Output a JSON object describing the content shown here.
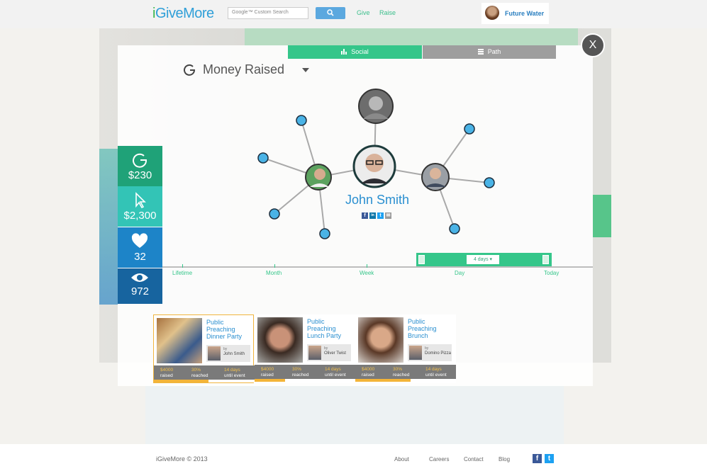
{
  "header": {
    "logo_prefix": "i",
    "logo_rest": "GiveMore",
    "search_placeholder": "Google™ Custom Search",
    "nav": [
      "Give",
      "Raise"
    ],
    "user_name": "Future Water"
  },
  "modal": {
    "close_label": "X",
    "tabs": [
      {
        "label": "Social",
        "active": true
      },
      {
        "label": "Path",
        "active": false
      }
    ],
    "metric": "Money Raised",
    "person_name": "John Smith",
    "socials": [
      "f",
      "in",
      "t",
      "✉"
    ]
  },
  "stats": [
    {
      "value": "$230",
      "icon": "give-icon",
      "color": "#1fa278"
    },
    {
      "value": "$2,300",
      "icon": "cursor-icon",
      "color": "#33c4b6"
    },
    {
      "value": "32",
      "icon": "heart-icon",
      "color": "#1d84c8"
    },
    {
      "value": "972",
      "icon": "eye-icon",
      "color": "#17649f"
    }
  ],
  "timeline": {
    "labels": [
      "Lifetime",
      "Month",
      "Week",
      "Day",
      "Today"
    ],
    "range_value": "4 days ▾"
  },
  "campaigns": [
    {
      "title": "Public Preaching Dinner Party",
      "by_prefix": "by",
      "by_name": "John Smith",
      "raised": "$4000",
      "raised_label": "raised",
      "reached": "30%",
      "reached_label": "reached",
      "days": "14 days",
      "days_label": "until event",
      "progress": 0.55,
      "selected": true
    },
    {
      "title": "Public Preaching Lunch Party",
      "by_prefix": "by",
      "by_name": "Oliver Twist",
      "raised": "$4000",
      "raised_label": "raised",
      "reached": "30%",
      "reached_label": "reached",
      "days": "14 days",
      "days_label": "until event",
      "progress": 0.3,
      "selected": false
    },
    {
      "title": "Public Preaching Brunch",
      "by_prefix": "by",
      "by_name": "Domino Pizza",
      "raised": "$4000",
      "raised_label": "raised",
      "reached": "30%",
      "reached_label": "reached",
      "days": "14 days",
      "days_label": "until event",
      "progress": 0.55,
      "selected": false
    }
  ],
  "footer": {
    "copyright": "iGiveMore © 2013",
    "links": [
      "About",
      "Careers",
      "Contact",
      "Blog"
    ],
    "social": [
      "f",
      "t"
    ]
  },
  "colors": {
    "accent": "#35c68a",
    "blue": "#2a8fd0",
    "progress": "#f3b438"
  }
}
